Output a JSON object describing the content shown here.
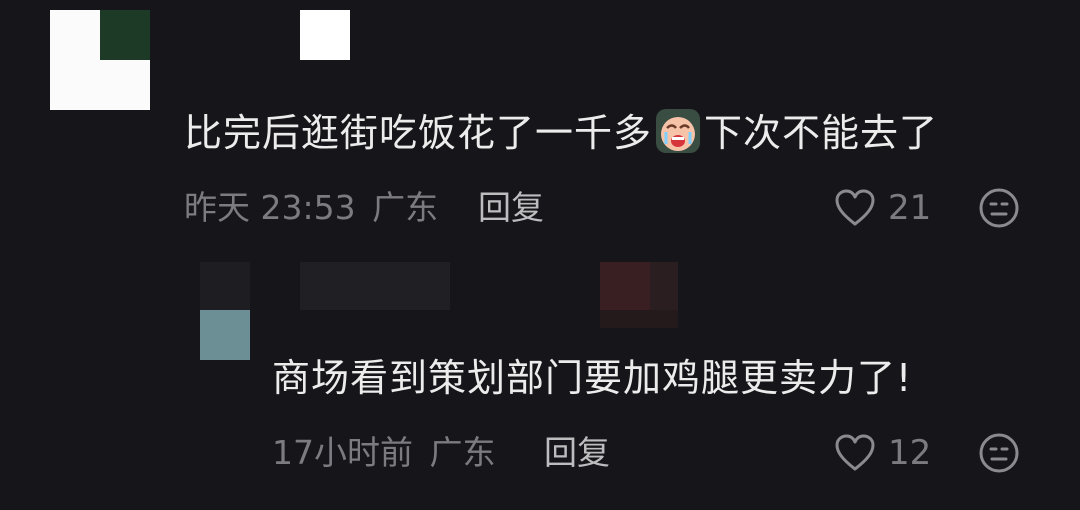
{
  "comments": [
    {
      "text_before_emoji": "比完后逛街吃饭花了一千多",
      "emoji": "crying-face-emoji",
      "text_after_emoji": "下次不能去了",
      "time": "昨天 23:53",
      "location": "广东",
      "reply_label": "回复",
      "likes": "21"
    },
    {
      "text": "商场看到策划部门要加鸡腿更卖力了!",
      "time": "17小时前",
      "location": "广东",
      "reply_label": "回复",
      "likes": "12"
    }
  ],
  "colors": {
    "background": "#16161a",
    "text_primary": "#ececec",
    "text_secondary": "#7b7b80"
  }
}
